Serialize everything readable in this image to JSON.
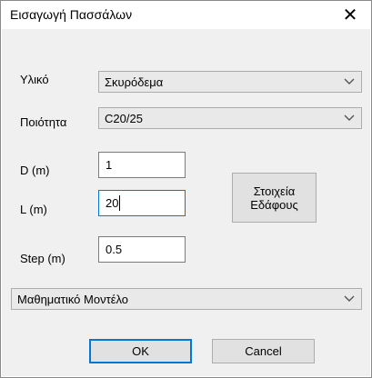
{
  "window": {
    "title": "Εισαγωγή Πασσάλων"
  },
  "material": {
    "label": "Υλικό",
    "value": "Σκυρόδεμα"
  },
  "quality": {
    "label": "Ποιότητα",
    "value": "C20/25"
  },
  "d": {
    "label": "D (m)",
    "value": "1"
  },
  "l": {
    "label": "L (m)",
    "value": "20"
  },
  "step": {
    "label": "Step (m)",
    "value": "0.5"
  },
  "soil_button": {
    "line1": "Στοιχεία",
    "line2": "Εδάφους"
  },
  "model": {
    "value": "Μαθηματικό Μοντέλο"
  },
  "buttons": {
    "ok": "OK",
    "cancel": "Cancel"
  },
  "icons": {
    "close": "close-icon",
    "dropdown": "chevron-down-icon"
  },
  "colors": {
    "focus_border": "#0078d7",
    "dialog_bg": "#f0f0f0"
  }
}
